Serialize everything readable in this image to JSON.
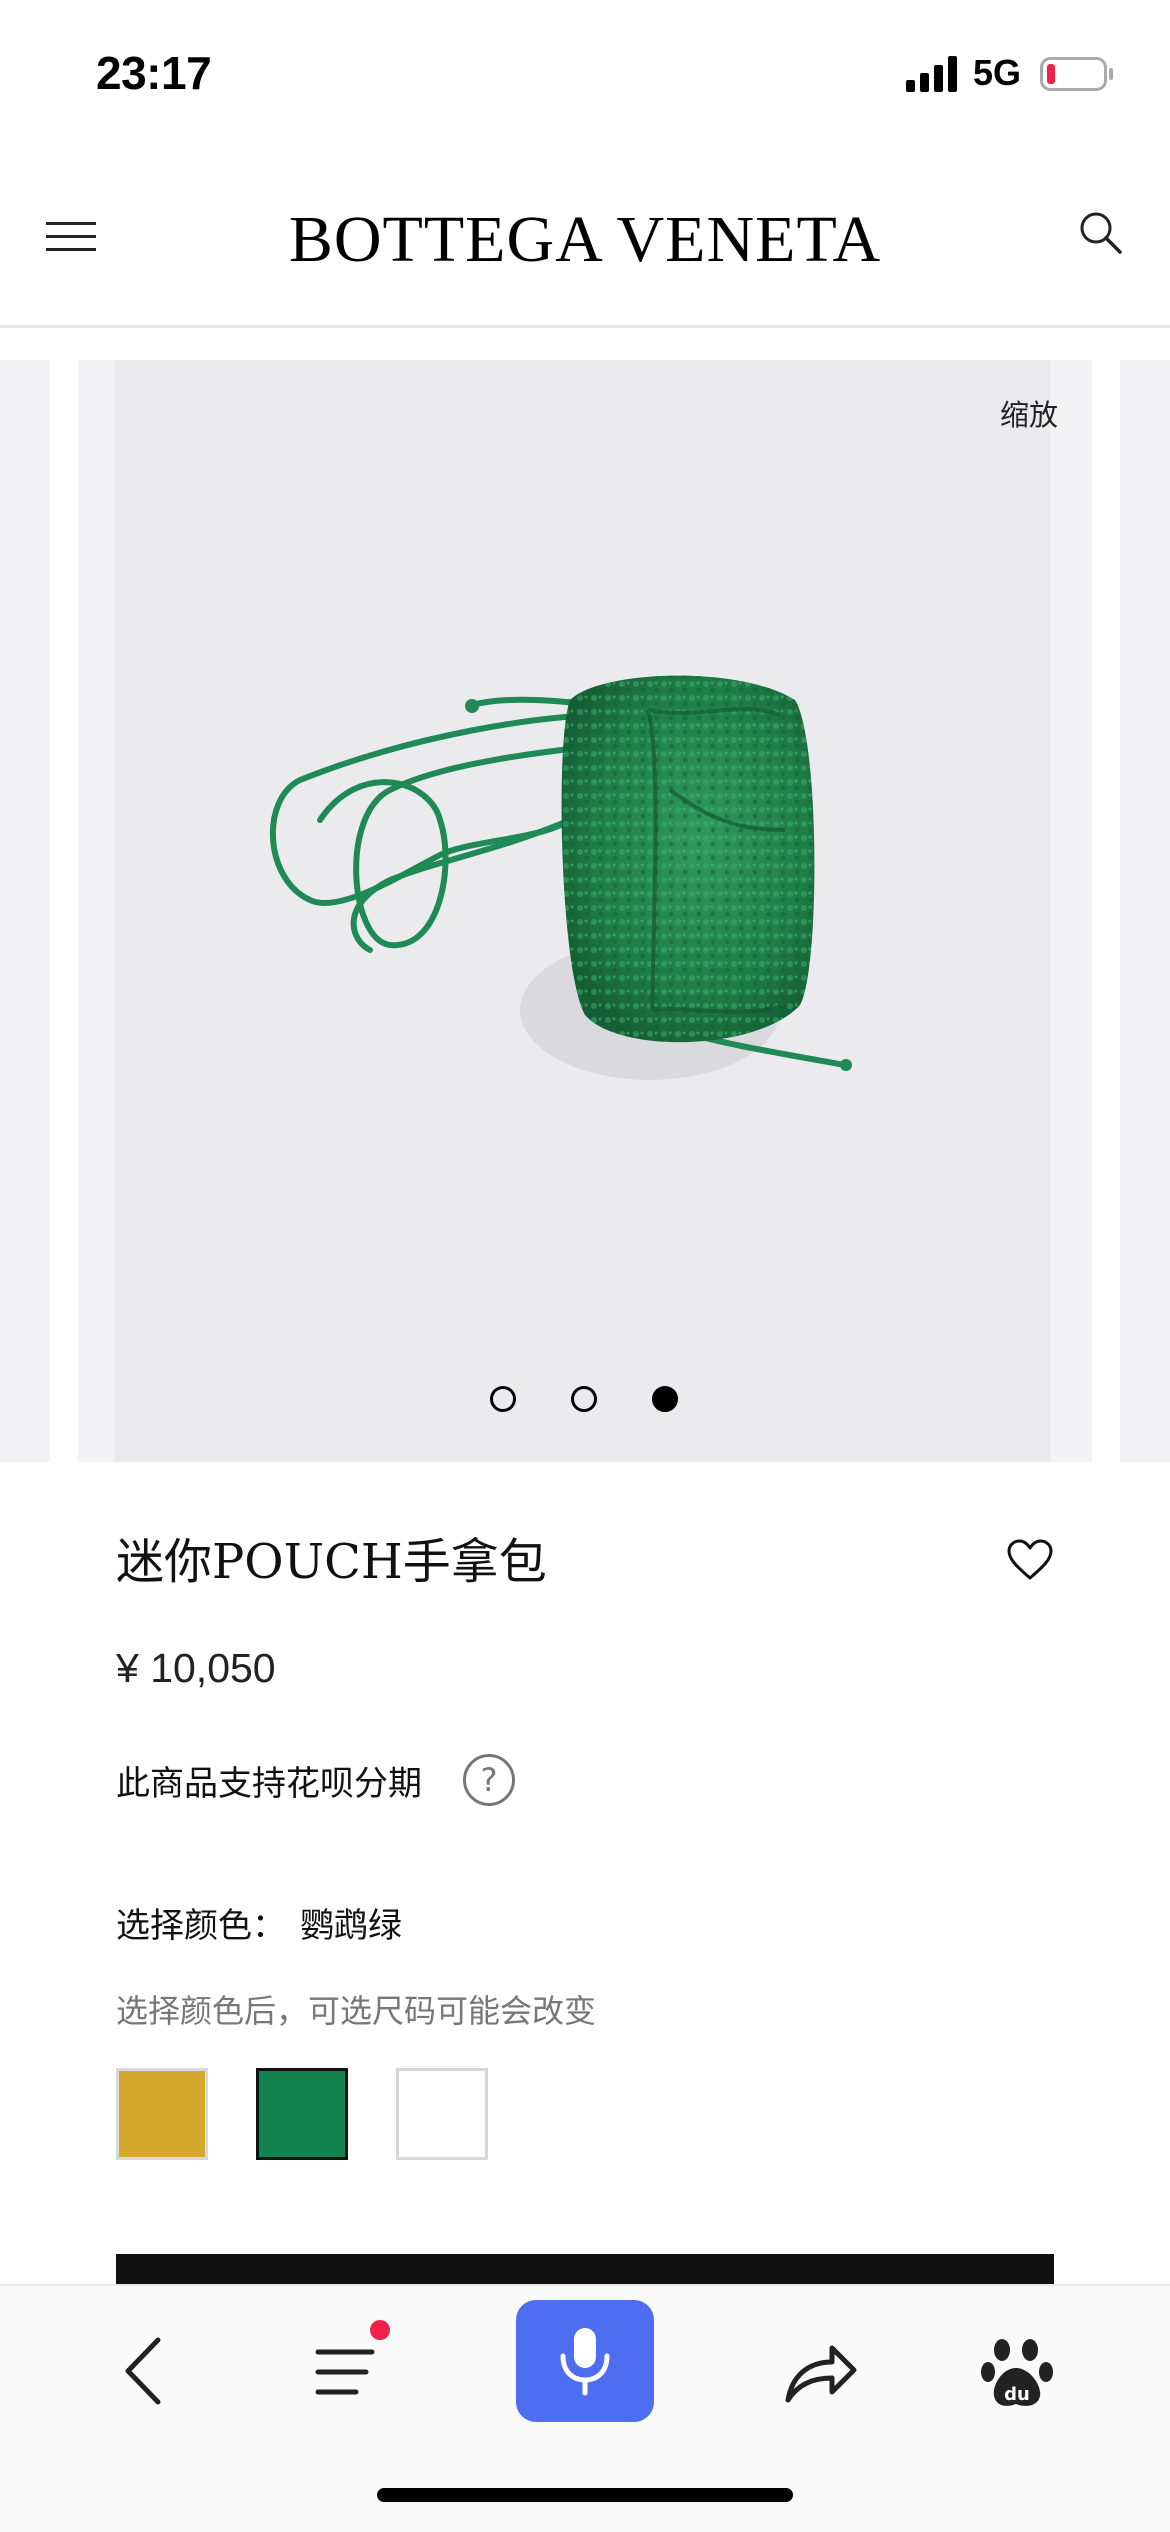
{
  "status_bar": {
    "time": "23:17",
    "network": "5G",
    "icons": [
      "signal-icon",
      "battery-low-icon"
    ]
  },
  "header": {
    "brand": "BOTTEGA VENETA",
    "icons": [
      "hamburger-menu-icon",
      "search-icon"
    ]
  },
  "carousel": {
    "zoom_label": "缩放",
    "slide_count": 3,
    "active_index": 2,
    "image_subject": "green-shearling-pouch-bag"
  },
  "product": {
    "title": "迷你POUCH手拿包",
    "price": "¥ 10,050",
    "installment_text": "此商品支持花呗分期",
    "color_label": "选择颜色：",
    "color_value": "鹦鹉绿",
    "color_hint": "选择颜色后，可选尺码可能会改变",
    "swatches": [
      {
        "name": "yellow",
        "color": "#d4a82c",
        "selected": false
      },
      {
        "name": "parakeet-green",
        "color": "#12834f",
        "selected": true
      },
      {
        "name": "white",
        "color": "#ffffff",
        "selected": false
      }
    ]
  },
  "toolbar": {
    "icons": [
      "back-icon",
      "list-icon",
      "microphone-icon",
      "share-icon",
      "baidu-paw-icon"
    ],
    "accent": "#4e6ef2",
    "notification_color": "#f0224b"
  }
}
